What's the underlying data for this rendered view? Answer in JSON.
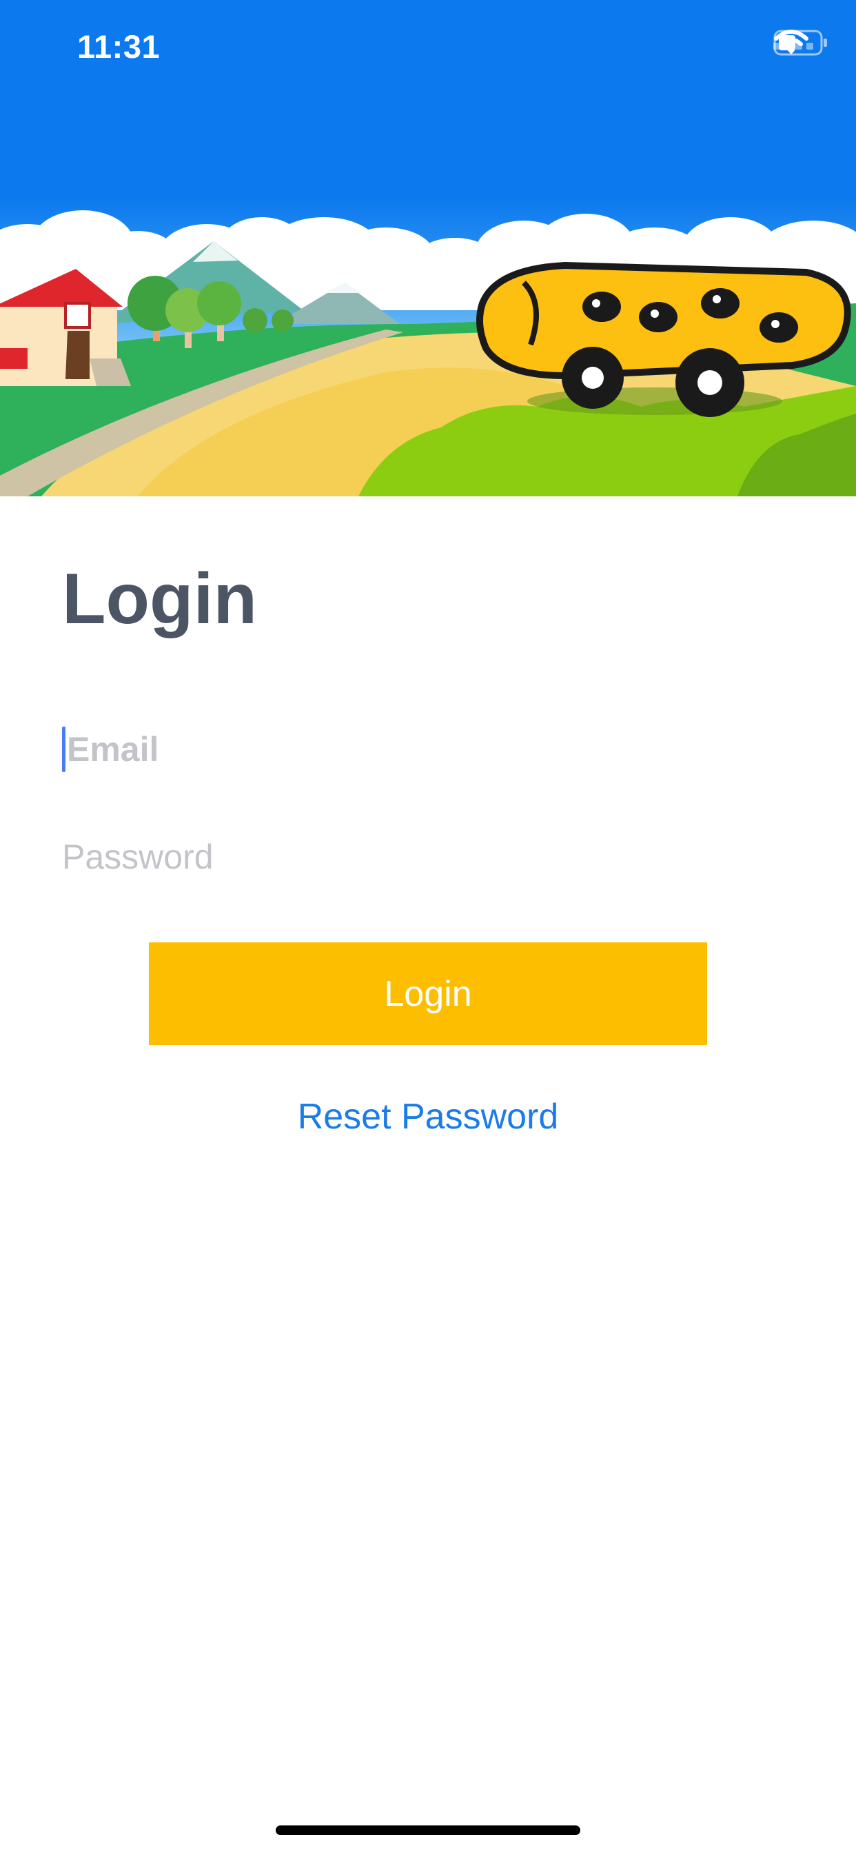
{
  "status_bar": {
    "time": "11:31",
    "icons": [
      "signal-dots-icon",
      "wifi-icon",
      "battery-icon"
    ]
  },
  "hero": {
    "image": "cartoon-school-bus-landscape-illustration"
  },
  "page": {
    "title": "Login"
  },
  "form": {
    "email_placeholder": "Email",
    "password_placeholder": "Password",
    "login_label": "Login",
    "reset_label": "Reset Password"
  },
  "colors": {
    "accent": "#fdbe00",
    "link": "#1a7ce8",
    "title": "#4b5563",
    "sky": "#0d79ee",
    "placeholder": "#c3c4c9"
  }
}
